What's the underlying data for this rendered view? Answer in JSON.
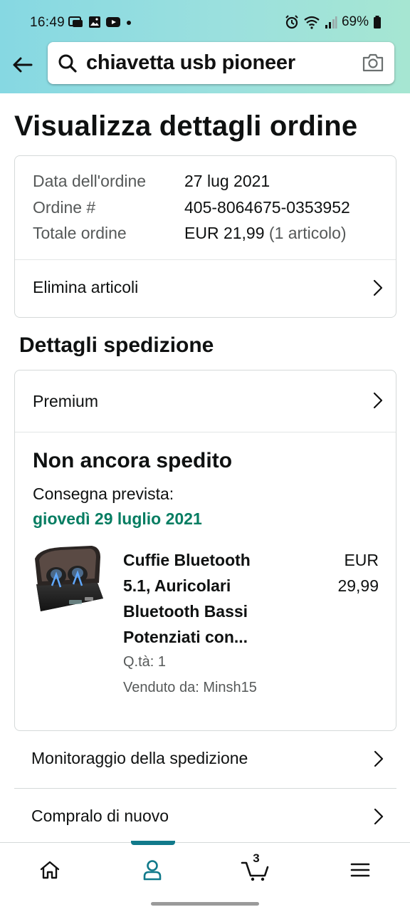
{
  "status_bar": {
    "time": "16:49",
    "battery": "69%"
  },
  "search": {
    "query": "chiavetta usb pioneer"
  },
  "page": {
    "title": "Visualizza dettagli ordine"
  },
  "order": {
    "date_label": "Data dell'ordine",
    "date_value": "27 lug 2021",
    "number_label": "Ordine #",
    "number_value": "405-8064675-0353952",
    "total_label": "Totale ordine",
    "total_value": "EUR 21,99",
    "total_items": "(1 articolo)",
    "delete_items_label": "Elimina articoli"
  },
  "shipping": {
    "section_title": "Dettagli spedizione",
    "premium_label": "Premium",
    "status_title": "Non ancora spedito",
    "delivery_label": "Consegna prevista:",
    "delivery_date": "giovedì 29 luglio 2021",
    "product": {
      "title": "Cuffie Bluetooth 5.1, Auricolari Bluetooth Bassi Potenziati con...",
      "price_currency": "EUR",
      "price_value": "29,99",
      "quantity": "Q.tà: 1",
      "seller": "Venduto da: Minsh15"
    }
  },
  "actions": {
    "tracking_label": "Monitoraggio della spedizione",
    "buy_again_label": "Compralo di nuovo"
  },
  "bottom_nav": {
    "cart_count": "3",
    "active_tab": "account"
  },
  "colors": {
    "accent_teal": "#117a8b",
    "delivery_green": "#067d62",
    "header_gradient_start": "#86d8e2",
    "header_gradient_end": "#a6e6d2"
  }
}
